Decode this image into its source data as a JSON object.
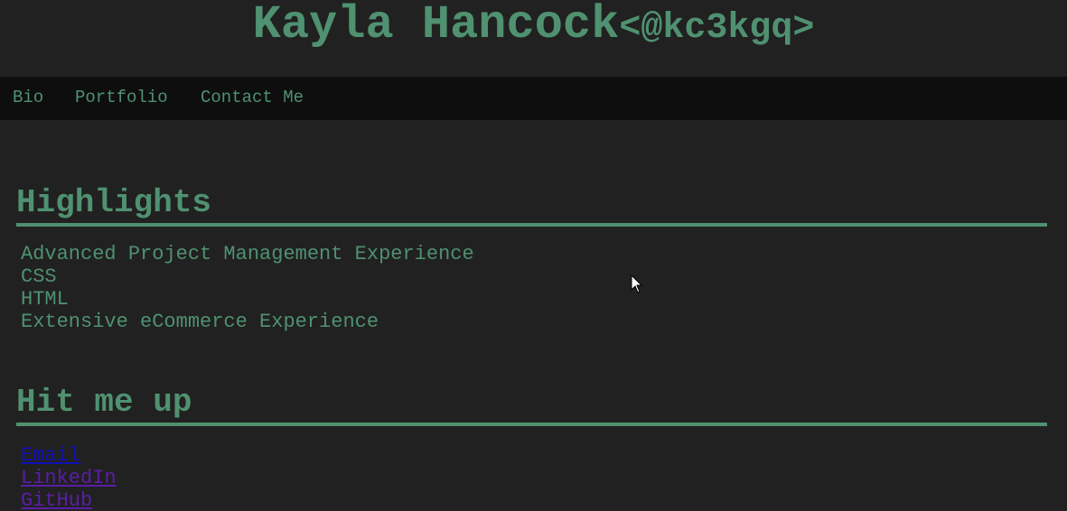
{
  "header": {
    "name": "Kayla Hancock",
    "handle": "<@kc3kgq>"
  },
  "nav": {
    "items": [
      "Bio",
      "Portfolio",
      "Contact Me"
    ]
  },
  "highlights": {
    "heading": "Highlights",
    "items": [
      "Advanced Project Management Experience",
      "CSS",
      "HTML",
      "Extensive eCommerce Experience"
    ]
  },
  "contact": {
    "heading": "Hit me up",
    "links": [
      "Email",
      "LinkedIn",
      "GitHub"
    ]
  },
  "colors": {
    "accent": "#4f9170",
    "background": "#212121",
    "nav_background": "#0e0e0e",
    "link_unvisited": "#1010b8",
    "link_visited": "#5a1ea6"
  }
}
